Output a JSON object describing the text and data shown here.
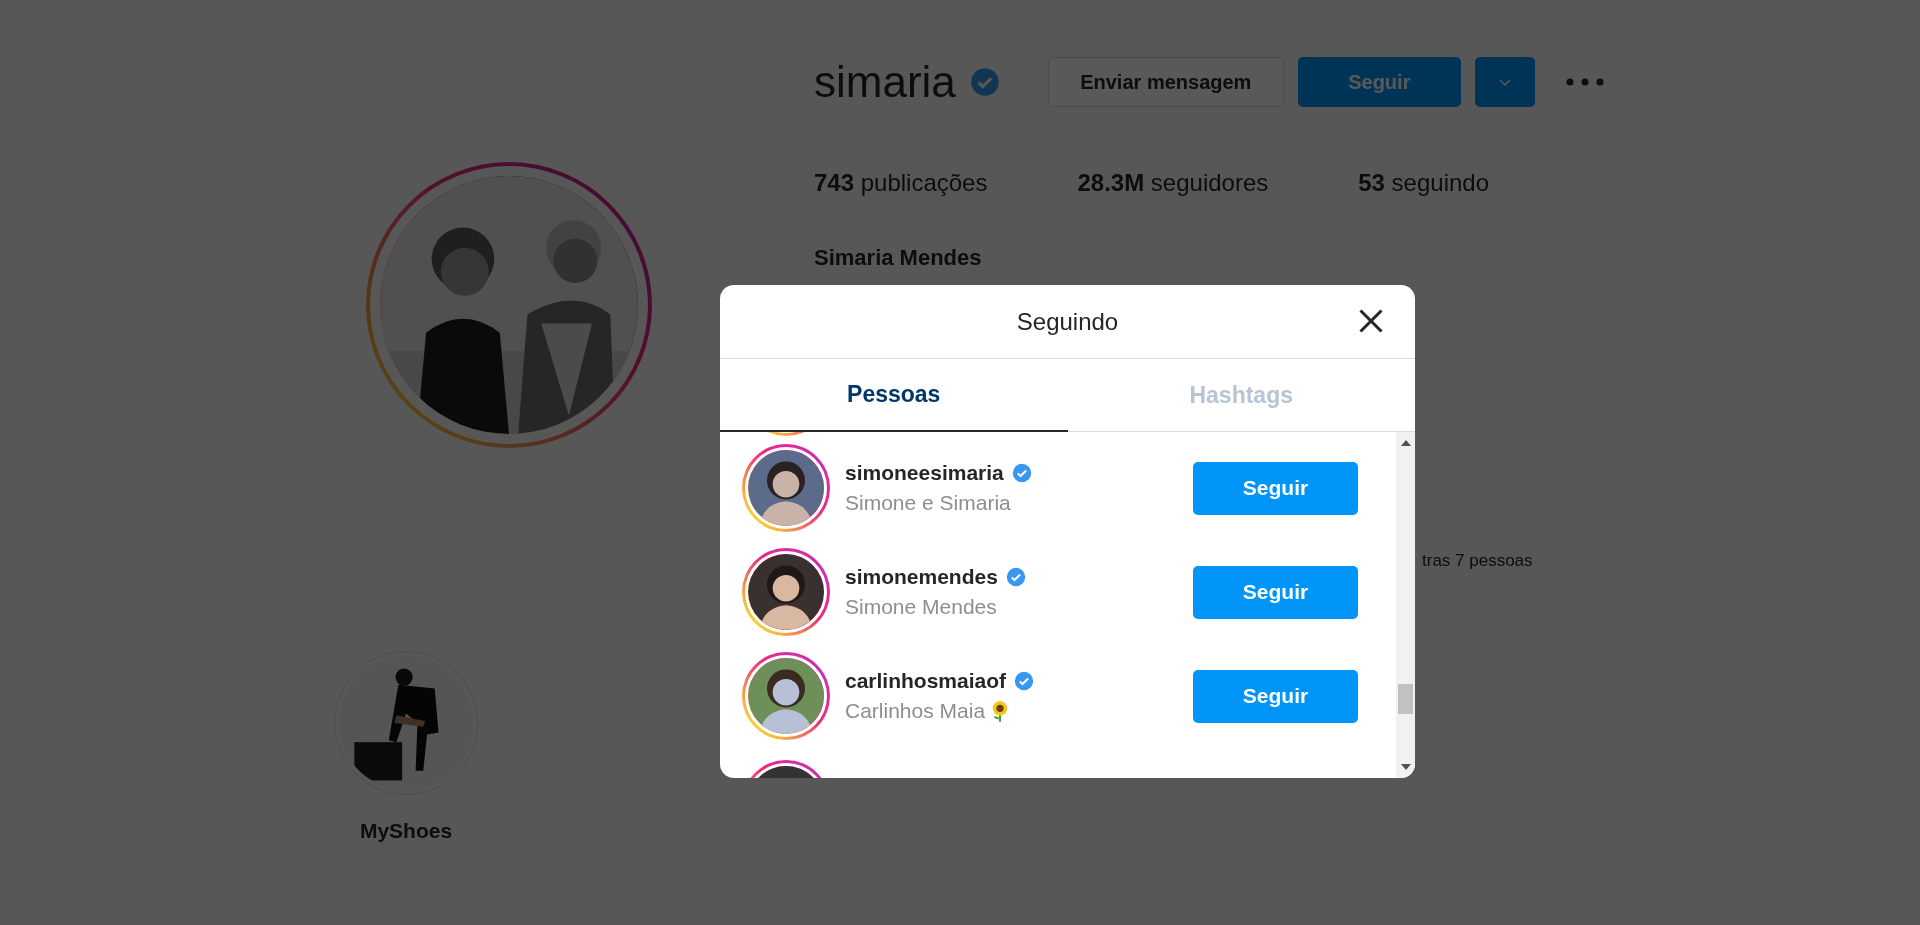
{
  "profile": {
    "username": "simaria",
    "verified": true,
    "actions": [
      "Enviar mensagem",
      "Seguir"
    ],
    "stats": [
      "**743** publicações",
      "**28.3M** seguidores",
      "**53** seguindo"
    ],
    "full_name": "Simaria Mendes",
    "followed_by": "tras 7 pessoas"
  },
  "highlights": [
    {
      "label": "MyShoes"
    }
  ],
  "modal": {
    "title": "Seguindo",
    "tabs": [
      {
        "label": "Pessoas",
        "selected": true
      },
      {
        "label": "Hashtags",
        "selected": false
      }
    ],
    "rows": [
      {
        "kind": "plain",
        "username": "simoneesimaria",
        "verified": true,
        "full_name": "Simone e Simaria",
        "button": "Seguir"
      },
      {
        "kind": "plain",
        "username": "simonemendes",
        "verified": true,
        "full_name": "Simone Mendes",
        "button": "Seguir"
      },
      {
        "kind": "sunflower",
        "username": "carlinhosmaiaof",
        "verified": true,
        "full_name": "Carlinhos Maia",
        "button": "Seguir"
      }
    ]
  }
}
